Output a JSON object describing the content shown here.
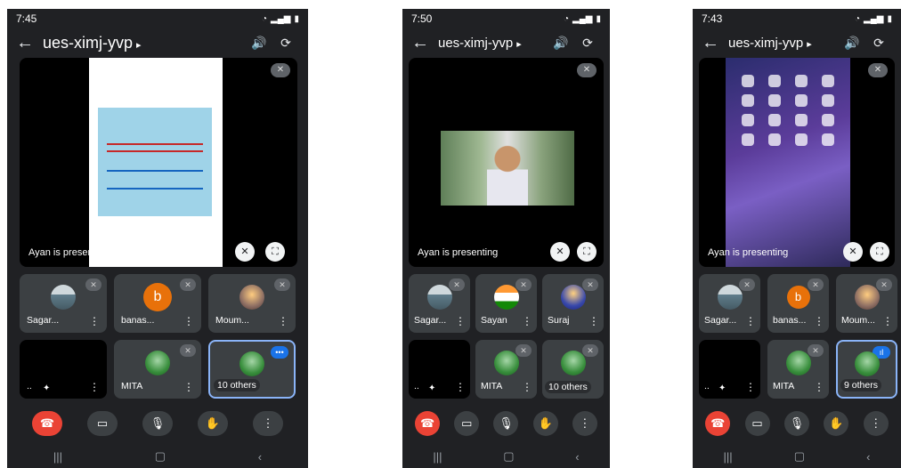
{
  "phones": [
    {
      "status_time": "7:45",
      "meeting_title": "ues-ximj-yvp",
      "presenting_text": "Ayan is presenting",
      "tiles": [
        {
          "name": "Sagar...",
          "avatar": "building"
        },
        {
          "name": "banas...",
          "avatar": "letter",
          "letter": "b"
        },
        {
          "name": "Moum...",
          "avatar": "people"
        },
        {
          "name": "..",
          "avatar": "none"
        },
        {
          "name": "MITA",
          "avatar": "tree"
        },
        {
          "name": "10 others",
          "avatar": "tree"
        }
      ]
    },
    {
      "status_time": "7:50",
      "meeting_title": "ues-ximj-yvp",
      "presenting_text": "Ayan is presenting",
      "tiles": [
        {
          "name": "Sagar...",
          "avatar": "building"
        },
        {
          "name": "Sayan",
          "avatar": "flag"
        },
        {
          "name": "Suraj",
          "avatar": "person"
        },
        {
          "name": "..",
          "avatar": "none"
        },
        {
          "name": "MITA",
          "avatar": "tree"
        },
        {
          "name": "10 others",
          "avatar": "tree"
        }
      ]
    },
    {
      "status_time": "7:43",
      "meeting_title": "ues-ximj-yvp",
      "presenting_text": "Ayan is presenting",
      "tiles": [
        {
          "name": "Sagar...",
          "avatar": "building"
        },
        {
          "name": "banas...",
          "avatar": "letter",
          "letter": "b"
        },
        {
          "name": "Moum...",
          "avatar": "people"
        },
        {
          "name": "..",
          "avatar": "none"
        },
        {
          "name": "MITA",
          "avatar": "tree"
        },
        {
          "name": "9 others",
          "avatar": "tree"
        }
      ]
    }
  ],
  "icons": {
    "back": "arrow-back-icon",
    "speaker": "speaker-icon",
    "switch_camera": "switch-camera-icon",
    "muted": "mic-off-icon",
    "end_call": "end-call-icon",
    "camera": "camera-icon",
    "mic": "mic-icon",
    "hand": "raise-hand-icon",
    "more": "more-vert-icon"
  },
  "colors": {
    "background": "#202124",
    "tile": "#3c4043",
    "end_call": "#ea4335",
    "accent": "#8ab4f8"
  }
}
